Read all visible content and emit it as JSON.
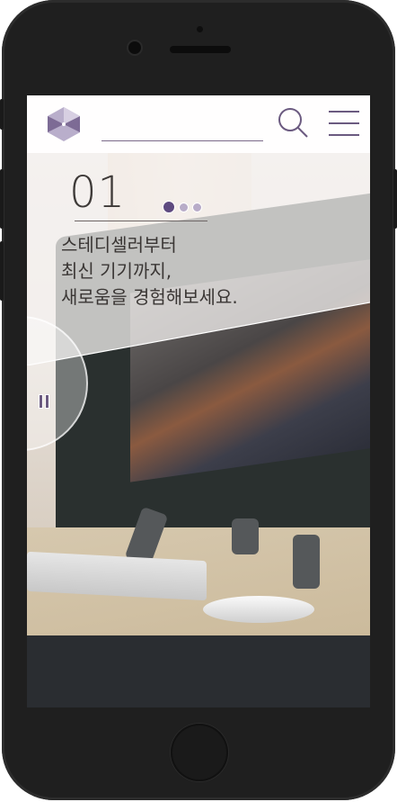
{
  "header": {
    "logo": "hexagon-logo",
    "search_icon": "search-icon",
    "menu_icon": "hamburger-menu-icon"
  },
  "hero": {
    "slide_number": "01",
    "slide_index": 1,
    "slide_count": 3,
    "headline_lines": [
      "스테디셀러부터",
      "최신 기기까지,",
      "새로움을 경험해보세요."
    ]
  },
  "controls": {
    "pause_icon": "pause-icon"
  },
  "colors": {
    "accent": "#6b5a80",
    "pager_active": "#5e4a80",
    "pager_inactive": "#b8acc8"
  }
}
